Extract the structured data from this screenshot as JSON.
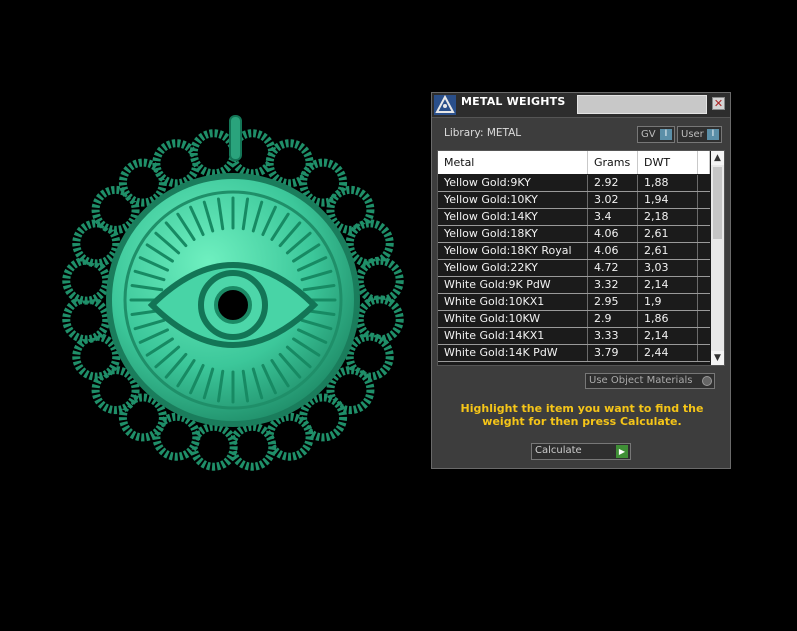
{
  "viewport": {
    "model_color": "#3cc79a"
  },
  "panel": {
    "title": "METAL WEIGHTS",
    "close_symbol": "✕",
    "library_label": "Library: METAL",
    "gv_toggle": {
      "label": "GV",
      "indicator": "I"
    },
    "user_toggle": {
      "label": "User",
      "indicator": "I"
    },
    "columns": [
      "Metal",
      "Grams",
      "DWT"
    ],
    "rows": [
      {
        "metal": "Yellow Gold:9KY",
        "grams": "2.92",
        "dwt": "1,88"
      },
      {
        "metal": "Yellow Gold:10KY",
        "grams": "3.02",
        "dwt": "1,94"
      },
      {
        "metal": "Yellow Gold:14KY",
        "grams": "3.4",
        "dwt": "2,18"
      },
      {
        "metal": "Yellow Gold:18KY",
        "grams": "4.06",
        "dwt": "2,61"
      },
      {
        "metal": "Yellow Gold:18KY Royal",
        "grams": "4.06",
        "dwt": "2,61"
      },
      {
        "metal": "Yellow Gold:22KY",
        "grams": "4.72",
        "dwt": "3,03"
      },
      {
        "metal": "White Gold:9K PdW",
        "grams": "3.32",
        "dwt": "2,14"
      },
      {
        "metal": "White Gold:10KX1",
        "grams": "2.95",
        "dwt": "1,9"
      },
      {
        "metal": "White Gold:10KW",
        "grams": "2.9",
        "dwt": "1,86"
      },
      {
        "metal": "White Gold:14KX1",
        "grams": "3.33",
        "dwt": "2,14"
      },
      {
        "metal": "White Gold:14K PdW",
        "grams": "3.79",
        "dwt": "2,44"
      }
    ],
    "use_object_materials": "Use Object Materials",
    "instructions": "Highlight the item you want to find the weight for then press Calculate.",
    "calculate_label": "Calculate",
    "calculate_go": "▶",
    "scroll_up": "▲",
    "scroll_down": "▼"
  }
}
